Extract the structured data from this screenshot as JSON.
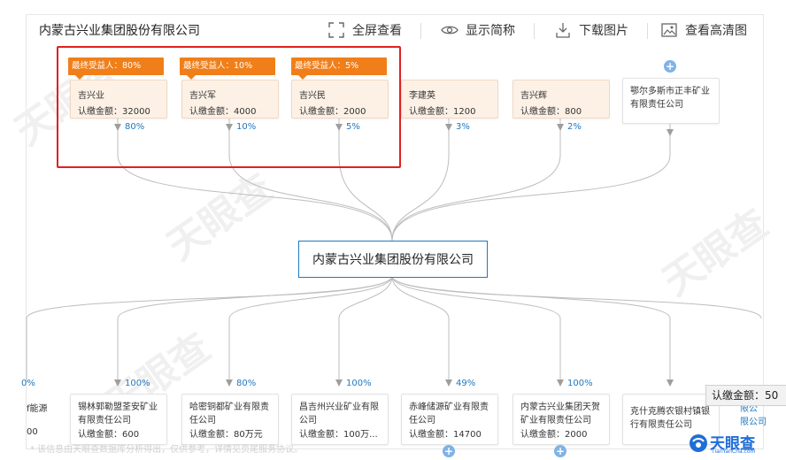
{
  "header": {
    "title": "内蒙古兴业集团股份有限公司",
    "fullscreen_label": "全屏查看",
    "short_name_label": "显示简称",
    "download_label": "下载图片",
    "hd_label": "查看高清图"
  },
  "center_company": "内蒙古兴业集团股份有限公司",
  "shareholders": [
    {
      "tag": "最终受益人：80%",
      "name": "吉兴业",
      "amount": "认缴金额：32000",
      "pct": "80%"
    },
    {
      "tag": "最终受益人：10%",
      "name": "吉兴军",
      "amount": "认缴金额：4000",
      "pct": "10%"
    },
    {
      "tag": "最终受益人：5%",
      "name": "吉兴民",
      "amount": "认缴金额：2000",
      "pct": "5%"
    },
    {
      "name": "李建英",
      "amount": "认缴金额：1200",
      "pct": "3%"
    },
    {
      "name": "吉兴辉",
      "amount": "认缴金额：800",
      "pct": "2%"
    },
    {
      "name_multi": "鄂尔多斯市正丰矿业有限责任公司"
    }
  ],
  "investments": [
    {
      "name": "锡林郭勒盟荃安矿业有限责任公司",
      "amount": "认缴金额：600",
      "pct": "100%"
    },
    {
      "name": "哈密铜都矿业有限责任公司",
      "amount": "认缴金额：80万元",
      "pct": "80%"
    },
    {
      "name": "昌吉州兴业矿业有限公司",
      "amount": "认缴金额：100万...",
      "pct": "100%"
    },
    {
      "name": "赤峰储源矿业有限责任公司",
      "amount": "认缴金额：14700",
      "pct": "49%"
    },
    {
      "name": "内蒙古兴业集团天贺矿业有限责任公司",
      "amount": "认缴金额：2000",
      "pct": "100%"
    },
    {
      "name": "克什克腾农银村镇银行有限责任公司"
    }
  ],
  "left_partial": {
    "pct": "0%",
    "name": "f能源",
    "amount": "00"
  },
  "right_partial": {
    "line1": "限公",
    "line2": "限公司"
  },
  "tooltip": "认缴金额：50",
  "footer": "* 该信息由天眼查数据库分析得出，仅供参考，详情见页尾服务协议。",
  "brand": {
    "name": "天眼查",
    "url": "TianYanCha.com"
  },
  "watermark": "天眼查",
  "colors": {
    "accent": "#1f78c1",
    "tag": "#f07f1a",
    "highlight": "#e02020"
  }
}
